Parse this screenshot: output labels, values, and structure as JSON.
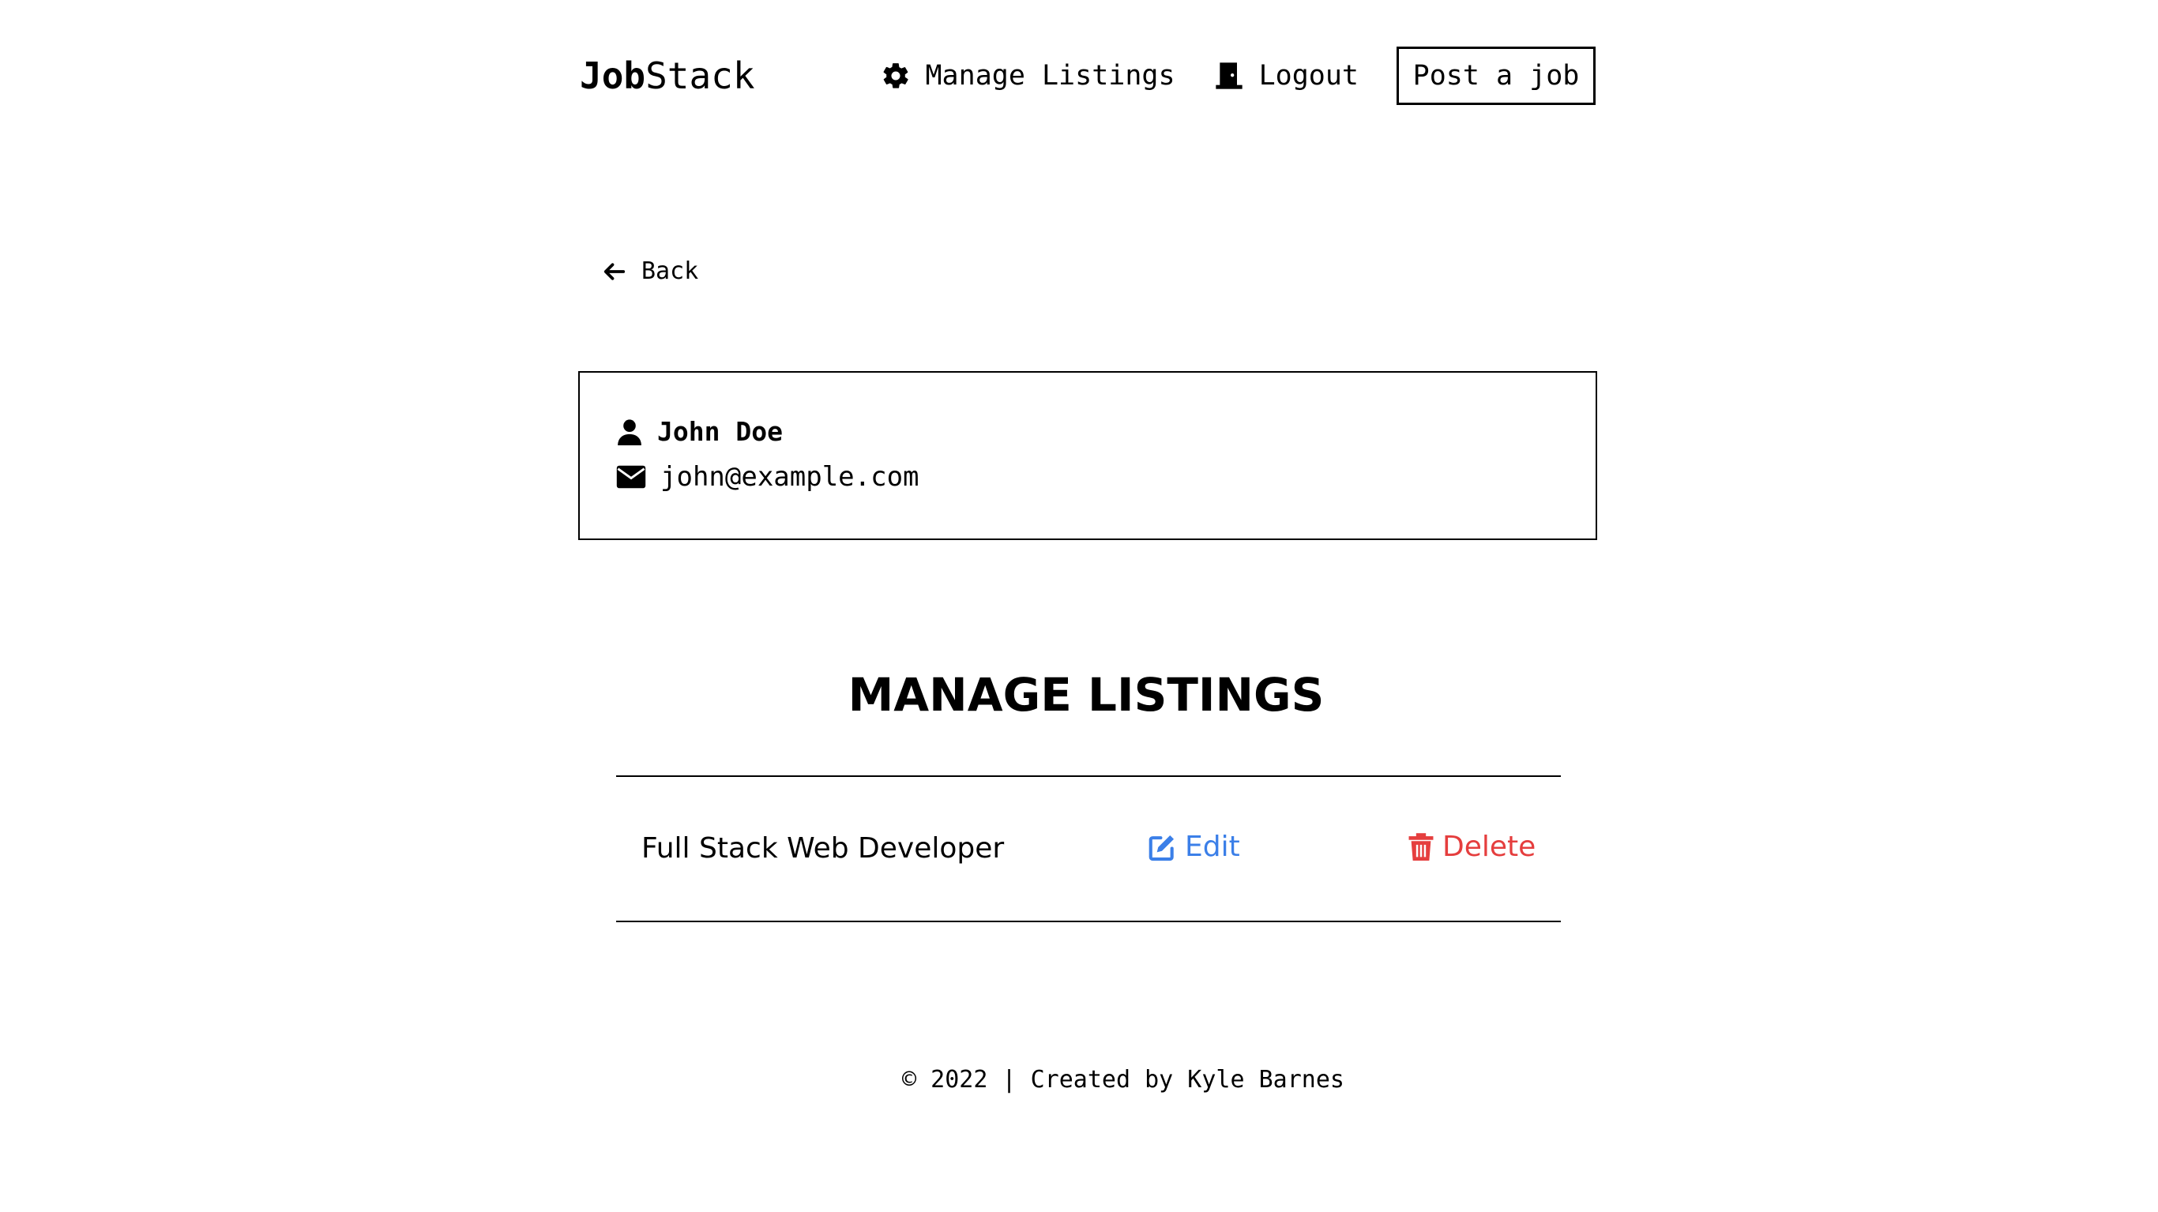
{
  "header": {
    "logo_bold": "Job",
    "logo_regular": "Stack",
    "manage_listings_label": "Manage Listings",
    "logout_label": "Logout",
    "post_job_label": "Post a job"
  },
  "back": {
    "label": "Back"
  },
  "user": {
    "name": "John Doe",
    "email": "john@example.com"
  },
  "manage": {
    "title": "MANAGE LISTINGS",
    "listings": [
      {
        "title": "Full Stack Web Developer",
        "edit_label": "Edit",
        "delete_label": "Delete"
      }
    ]
  },
  "footer": {
    "text": "© 2022 | Created by Kyle Barnes"
  },
  "colors": {
    "edit": "#3b7fe8",
    "delete": "#e53e3e"
  },
  "icons": {
    "manage": "gear-icon",
    "logout": "door-icon",
    "back": "arrow-left-icon",
    "user": "user-icon",
    "email": "envelope-icon",
    "edit": "pen-to-square-icon",
    "delete": "trash-icon"
  }
}
